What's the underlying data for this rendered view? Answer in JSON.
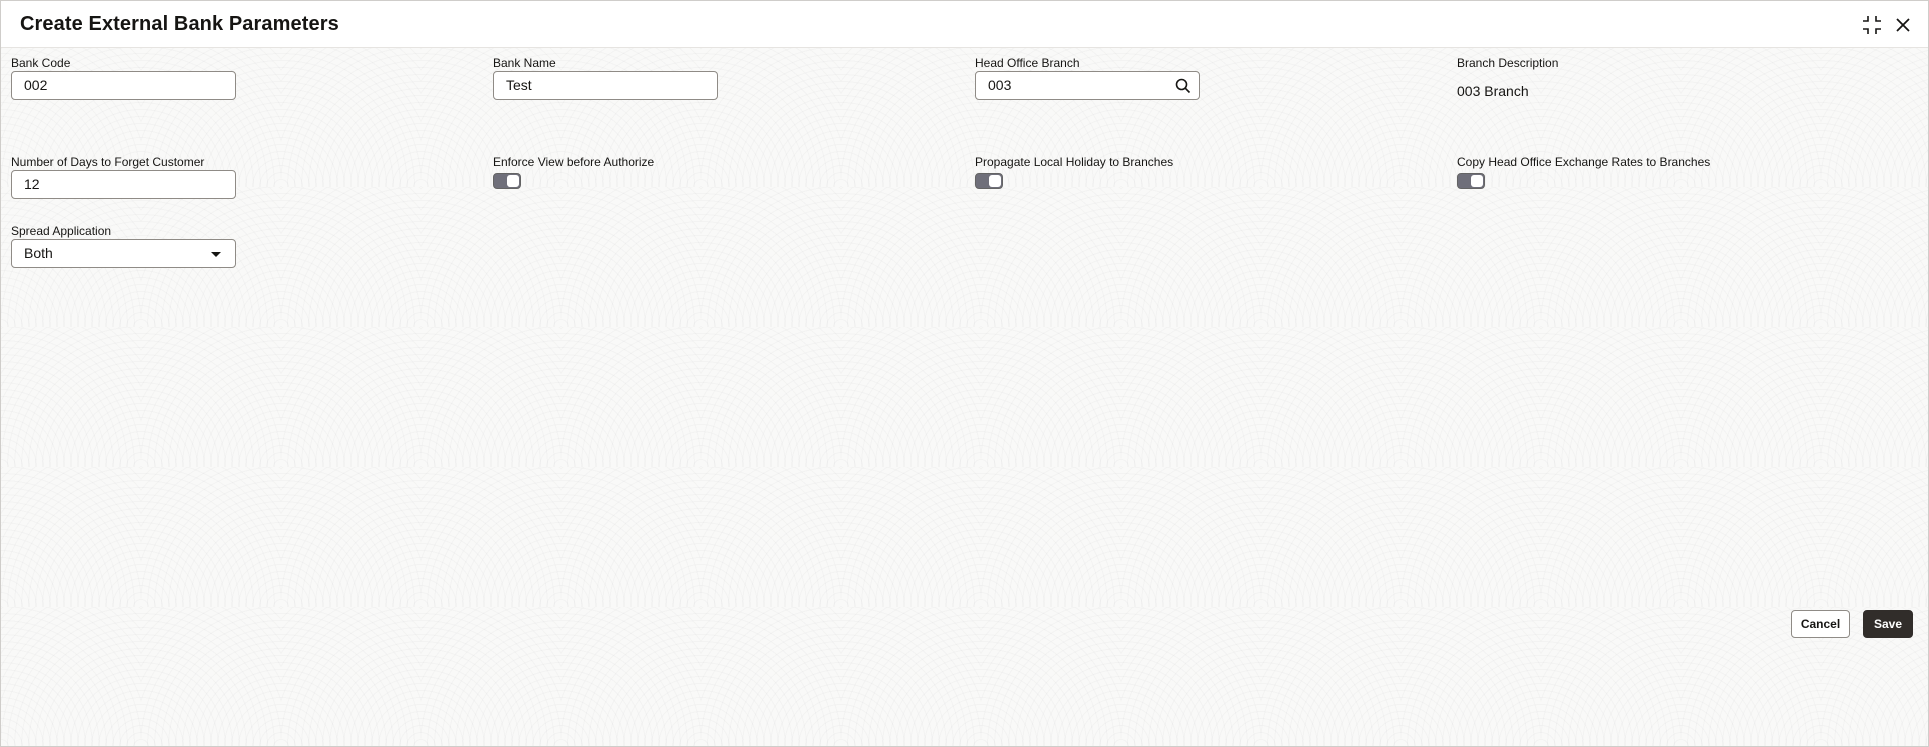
{
  "dialog": {
    "title": "Create External Bank Parameters",
    "icons": {
      "maximize": "collapse-icon",
      "close": "close-icon"
    }
  },
  "form": {
    "bank_code": {
      "label": "Bank Code",
      "value": "002"
    },
    "bank_name": {
      "label": "Bank Name",
      "value": "Test"
    },
    "head_office_branch": {
      "label": "Head Office Branch",
      "value": "003"
    },
    "branch_description": {
      "label": "Branch Description",
      "value": "003 Branch"
    },
    "days_to_forget": {
      "label": "Number of Days to Forget Customer",
      "value": "12"
    },
    "enforce_view": {
      "label": "Enforce View before Authorize",
      "checked": true
    },
    "propagate_holiday": {
      "label": "Propagate Local Holiday to Branches",
      "checked": true
    },
    "copy_exchange_rates": {
      "label": "Copy Head Office Exchange Rates to Branches",
      "checked": true
    },
    "spread_application": {
      "label": "Spread Application",
      "value": "Both"
    }
  },
  "footer": {
    "cancel_label": "Cancel",
    "save_label": "Save"
  },
  "colors": {
    "toggle_on": "#6f6f7a",
    "primary_button": "#312d2a"
  }
}
